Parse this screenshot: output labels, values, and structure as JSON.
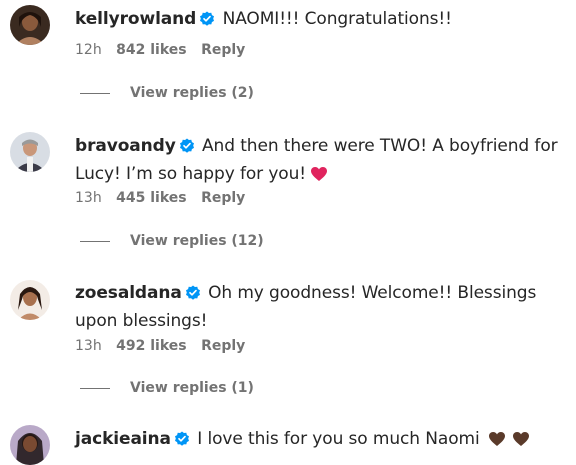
{
  "comments": [
    {
      "username": "kellyrowland",
      "text": "NAOMI!!! Congratulations!!",
      "time": "12h",
      "likes": "842 likes",
      "reply": "Reply",
      "view_replies": "View replies (2)"
    },
    {
      "username": "bravoandy",
      "text": "And then there were TWO! A boyfriend for Lucy! I’m so happy for you!",
      "emoji": "red-heart",
      "time": "13h",
      "likes": "445 likes",
      "reply": "Reply",
      "view_replies": "View replies (12)"
    },
    {
      "username": "zoesaldana",
      "text": "Oh my goodness! Welcome!! Blessings upon blessings!",
      "time": "13h",
      "likes": "492 likes",
      "reply": "Reply",
      "view_replies": "View replies (1)"
    },
    {
      "username": "jackieaina",
      "text": "I love this for you so much Naomi",
      "emoji": "brown-heart brown-heart"
    }
  ],
  "colors": {
    "verified": "#0095f6",
    "muted_text": "#737373",
    "red_heart": "#e0245e",
    "brown_heart": "#5a3a2a"
  }
}
